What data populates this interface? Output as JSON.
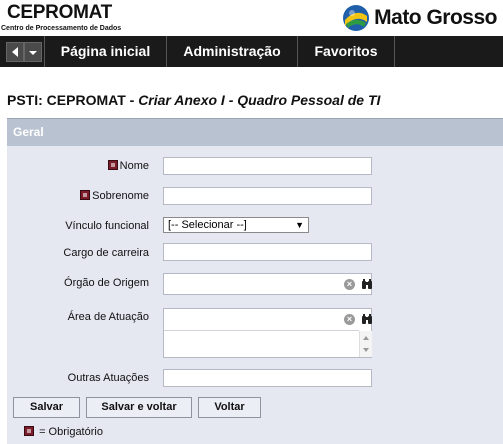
{
  "header": {
    "org_name": "CEPROMAT",
    "org_subtitle": "Centro de Processamento de Dados",
    "brand_name": "Mato Grosso"
  },
  "nav": {
    "items": [
      "Página inicial",
      "Administração",
      "Favoritos"
    ]
  },
  "page": {
    "title_prefix": "PSTI: CEPROMAT - ",
    "title_italic": "Criar Anexo I - Quadro Pessoal de TI"
  },
  "section": {
    "title": "Geral"
  },
  "form": {
    "nome_label": "Nome",
    "sobrenome_label": "Sobrenome",
    "vinculo_label": "Vínculo funcional",
    "vinculo_selected": "[-- Selecionar --]",
    "cargo_label": "Cargo de carreira",
    "orgao_label": "Órgão de Origem",
    "area_label": "Área de Atuação",
    "outras_label": "Outras Atuações"
  },
  "buttons": {
    "save": "Salvar",
    "save_back": "Salvar e voltar",
    "back": "Voltar"
  },
  "legend": {
    "text": "= Obrigatório"
  },
  "colors": {
    "navbar": "#1a1a1a",
    "section_header": "#b8c2d0",
    "form_bg": "#e5e7f1",
    "required_marker": "#7a1c2a"
  }
}
